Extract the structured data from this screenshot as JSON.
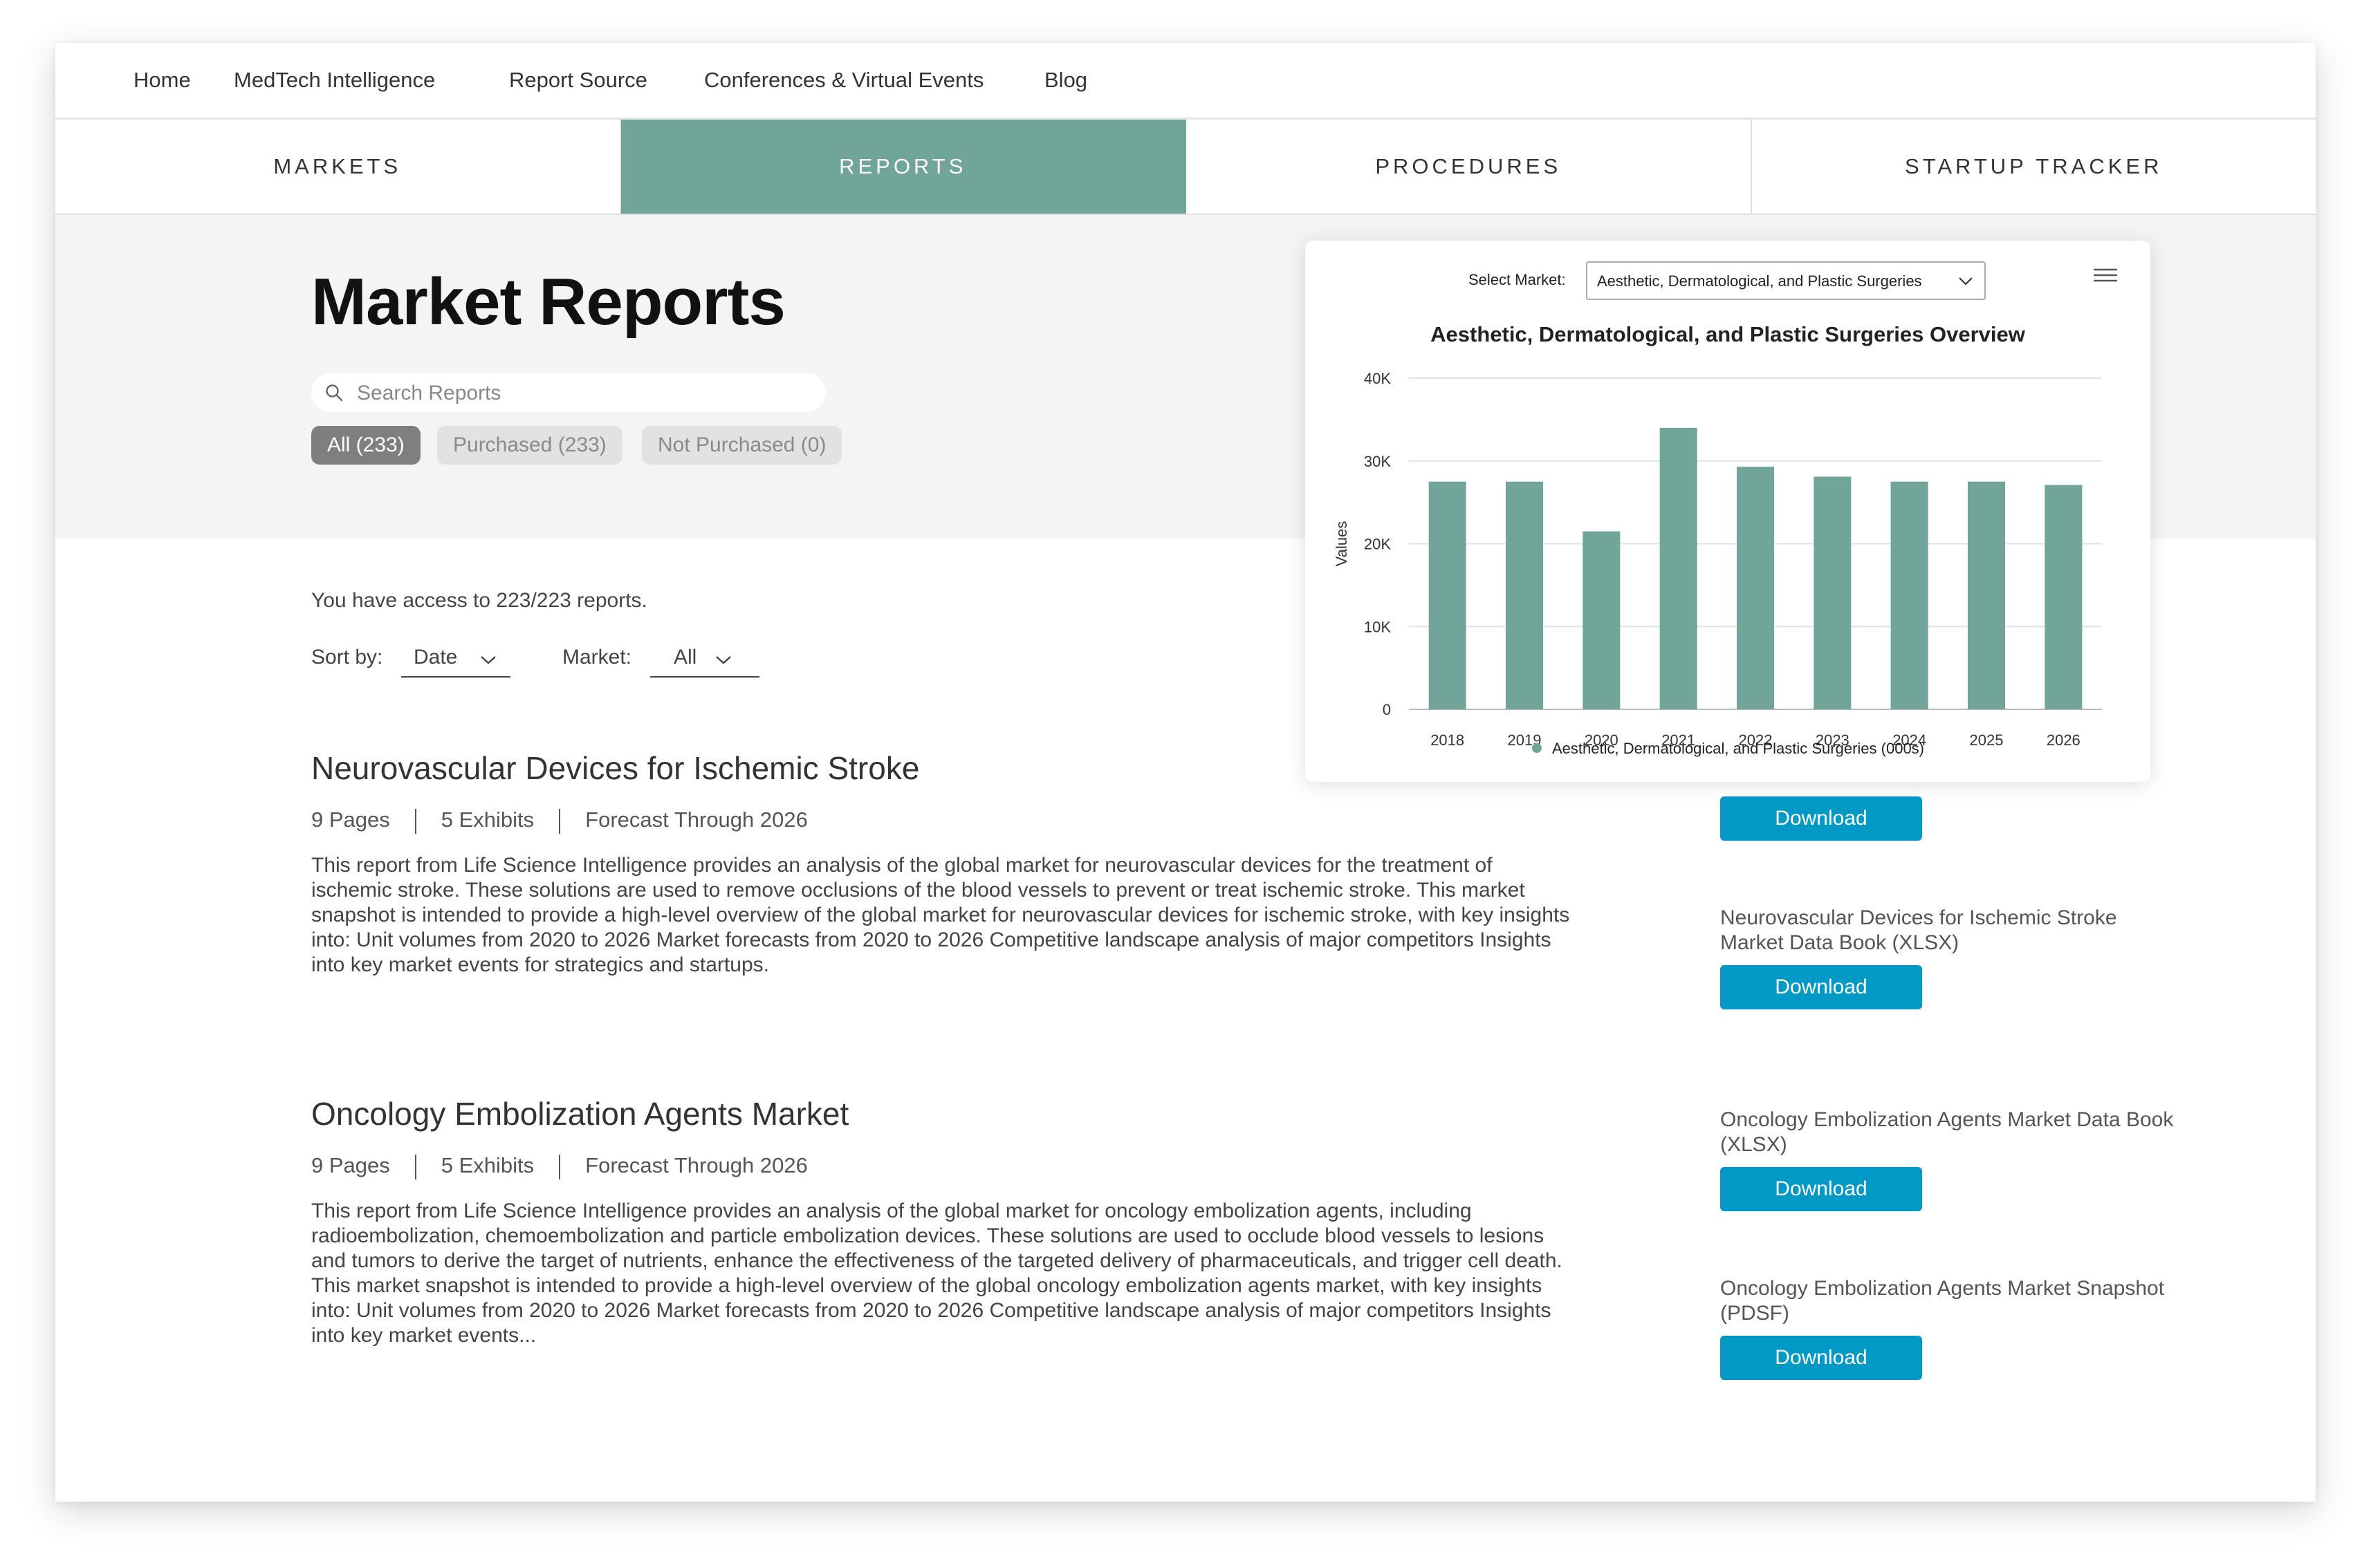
{
  "nav": {
    "links": [
      "Home",
      "MedTech Intelligence",
      "Report Source",
      "Conferences & Virtual Events",
      "Blog"
    ]
  },
  "tabs": [
    {
      "label": "MARKETS",
      "active": false
    },
    {
      "label": "REPORTS",
      "active": true
    },
    {
      "label": "PROCEDURES",
      "active": false
    },
    {
      "label": "STARTUP TRACKER",
      "active": false
    }
  ],
  "hero": {
    "title": "Market Reports",
    "search_placeholder": "Search Reports",
    "filters": [
      {
        "label": "All (233)",
        "selected": true
      },
      {
        "label": "Purchased (233)",
        "selected": false
      },
      {
        "label": "Not Purchased (0)",
        "selected": false
      }
    ]
  },
  "listing": {
    "access_text": "You have access to 223/223 reports.",
    "sort_label": "Sort by:",
    "sort_value": "Date",
    "market_label": "Market:",
    "market_value": "All"
  },
  "reports": [
    {
      "title": "Neurovascular Devices for Ischemic Stroke",
      "pages": "9 Pages",
      "exhibits": "5 Exhibits",
      "forecast": "Forecast Through 2026",
      "description": "This report from Life Science Intelligence provides an analysis of the global market for neurovascular devices for the treatment of ischemic stroke. These solutions are used to remove occlusions of the blood vessels to prevent or treat ischemic stroke. This market snapshot is intended to provide a high-level overview of the global market for neurovascular devices for ischemic stroke, with key insights into: Unit volumes from 2020 to 2026 Market forecasts from 2020 to 2026 Competitive landscape analysis of major competitors Insights into key market events for strategics and startups.",
      "downloads": [
        {
          "label": "",
          "button": "Download"
        },
        {
          "label": "Neurovascular Devices for Ischemic Stroke Market Data Book (XLSX)",
          "button": "Download"
        }
      ]
    },
    {
      "title": "Oncology Embolization Agents Market",
      "pages": "9 Pages",
      "exhibits": "5 Exhibits",
      "forecast": "Forecast Through 2026",
      "description": "This report from Life Science Intelligence provides an analysis of the global market for oncology embolization agents, including radioembolization, chemoembolization and particle embolization devices. These solutions are used to occlude blood vessels to lesions and tumors to derive the target of nutrients, enhance the effectiveness of the targeted delivery of pharmaceuticals, and trigger cell death. This market snapshot is intended to provide a high-level overview of the global oncology embolization agents market, with key insights into: Unit volumes from 2020 to 2026 Market forecasts from 2020 to 2026 Competitive landscape analysis of major competitors Insights into key market events...",
      "downloads": [
        {
          "label": "Oncology Embolization Agents Market Data Book (XLSX)",
          "button": "Download"
        },
        {
          "label": "Oncology Embolization Agents Market Snapshot (PDSF)",
          "button": "Download"
        }
      ]
    }
  ],
  "chart_widget": {
    "select_label": "Select Market:",
    "select_value": "Aesthetic, Dermatological, and Plastic Surgeries"
  },
  "chart_data": {
    "type": "bar",
    "title": "Aesthetic, Dermatological, and Plastic Surgeries Overview",
    "xlabel": "",
    "ylabel": "Values",
    "categories": [
      "2018",
      "2019",
      "2020",
      "2021",
      "2022",
      "2023",
      "2024",
      "2025",
      "2026"
    ],
    "series": [
      {
        "name": "Aesthetic, Dermatological, and Plastic Surgeries (000s)",
        "color": "#72a59a",
        "values": [
          27500,
          27500,
          21500,
          34000,
          29300,
          28100,
          27500,
          27500,
          27100
        ]
      }
    ],
    "ylim": [
      0,
      40000
    ],
    "yticks": [
      0,
      10000,
      20000,
      30000,
      40000
    ],
    "ytick_labels": [
      "0",
      "10K",
      "20K",
      "30K",
      "40K"
    ],
    "grid": true,
    "legend": "bottom"
  },
  "colors": {
    "accent": "#72a59a",
    "download_button": "#0399c6"
  }
}
